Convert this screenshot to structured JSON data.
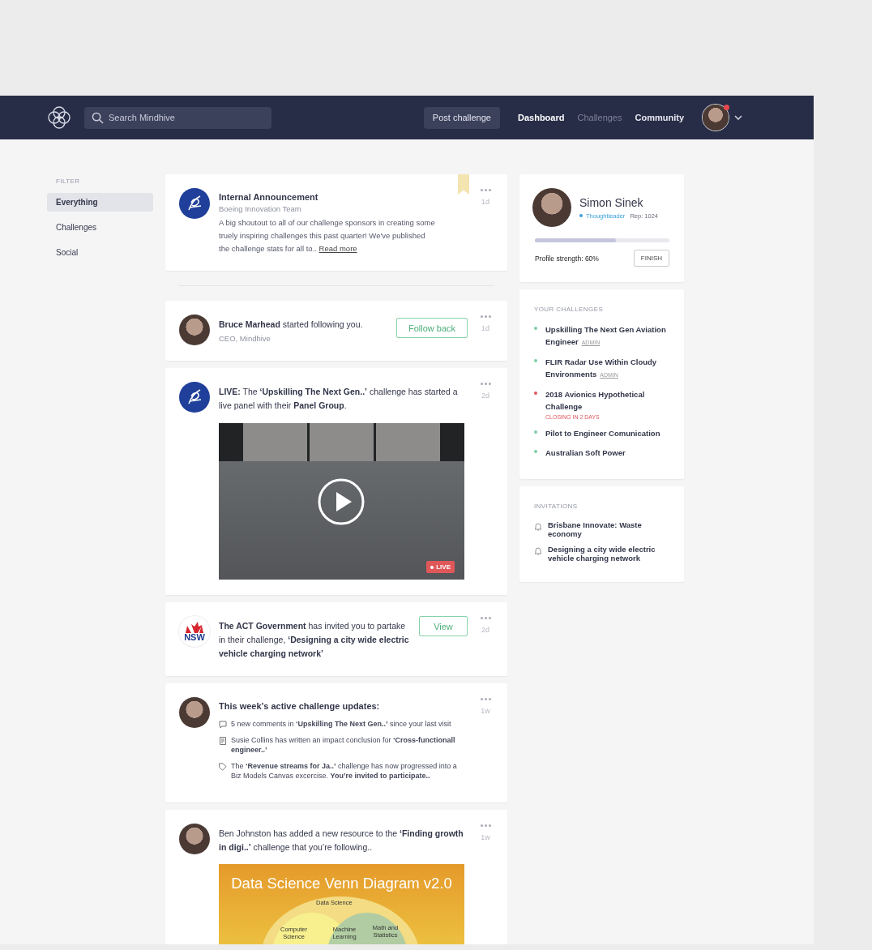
{
  "nav": {
    "search_placeholder": "Search Mindhive",
    "post_button": "Post challenge",
    "notification": true,
    "links": [
      {
        "label": "Dashboard",
        "selected": true,
        "muted": false
      },
      {
        "label": "Challenges",
        "selected": false,
        "muted": true
      },
      {
        "label": "Community",
        "selected": false,
        "muted": false
      }
    ]
  },
  "sidebar": {
    "heading": "FILTER",
    "items": [
      {
        "label": "Everything",
        "selected": true
      },
      {
        "label": "Challenges",
        "selected": false
      },
      {
        "label": "Social",
        "selected": false
      }
    ]
  },
  "feed": [
    {
      "kind": "announcement",
      "title": "Internal Announcement",
      "subtitle": "Boeing Innovation Team",
      "text": "A big shoutout to all of our challenge sponsors in creating some truely inspiring challenges this past quarter! We've published the challenge stats for all to..",
      "link": "Read more",
      "time": "1d",
      "bookmarked": true
    },
    {
      "kind": "divider"
    },
    {
      "kind": "follow",
      "text": "**Bruce Marhead** started following you.",
      "subtitle": "CEO, Mindhive",
      "button": "Follow back",
      "time": "1d"
    },
    {
      "kind": "live",
      "text": "**LIVE:** The **‘Upskilling The Next Gen..’** challenge has started a live panel with their **Panel Group**.",
      "badge": "LIVE",
      "time": "2d"
    },
    {
      "kind": "invite",
      "logo_text": "NSW",
      "text": "**The ACT Government** has invited you to partake in their challenge, **‘Designing a city wide electric vehicle charging network’**",
      "button": "View",
      "time": "2d"
    },
    {
      "kind": "updates",
      "title": "This week’s active challenge updates:",
      "time": "1w",
      "updates": [
        {
          "text": "5 new comments in **‘Upskilling The Next Gen..’** since your last visit"
        },
        {
          "text": "Susie Collins has written an impact conclusion for **‘Cross-functionall engineer..’**"
        },
        {
          "text": "The **‘Revenue streams for Ja..’** challenge has now progressed into a Biz Models Canvas excercise. **You’re invited to participate..**"
        }
      ]
    },
    {
      "kind": "resource",
      "text": "Ben Johnston has added a new resource to the **‘Finding growth in digi..’** challenge that you’re following..",
      "time": "1w",
      "image": {
        "title": "Data Science Venn Diagram v2.0",
        "outer": "Data Science",
        "left": "Computer Science",
        "middle": "Machine Learning",
        "right": "Math and Statistics"
      }
    }
  ],
  "profile": {
    "name": "Simon Sinek",
    "role": "Thoughtleader",
    "rep": "Rep: 1024",
    "level": 0.6,
    "strength": "Profile strength: 60%",
    "button": "FINISH"
  },
  "challenges": {
    "heading": "YOUR CHALLENGES",
    "items": [
      {
        "title": "Upskilling The Next Gen Aviation Engineer",
        "tag": "ADMIN",
        "color": "#7dcfa3"
      },
      {
        "title": "FLIR Radar Use Within Cloudy Environments",
        "tag": "ADMIN",
        "color": "#7dcfa3"
      },
      {
        "title": "2018 Avionics Hypothetical Challenge",
        "note": "CLOSING IN 2 DAYS",
        "color": "#e0575a"
      },
      {
        "title": "Pilot to Engineer Comunication",
        "color": "#7dcfa3"
      },
      {
        "title": "Australian Soft Power",
        "color": "#7dcfa3"
      }
    ]
  },
  "invitations": {
    "heading": "INVITATIONS",
    "items": [
      "Brisbane Innovate: Waste economy",
      "Designing a city wide electric vehicle charging network"
    ]
  }
}
